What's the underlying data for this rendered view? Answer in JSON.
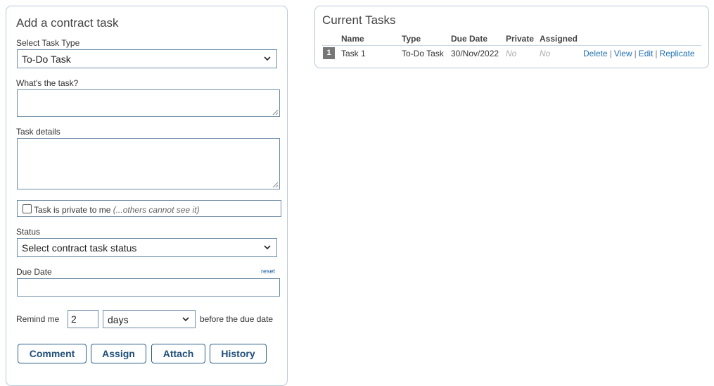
{
  "add_task": {
    "title": "Add a contract task",
    "task_type_label": "Select Task Type",
    "task_type_value": "To-Do Task",
    "whats_task_label": "What's the task?",
    "task_details_label": "Task details",
    "private_label": "Task is private to me",
    "private_hint": "(...others cannot see it)",
    "status_label": "Status",
    "status_value": "Select contract task status",
    "due_date_label": "Due Date",
    "reset_label": "reset",
    "remind_label": "Remind me",
    "remind_value": "2",
    "remind_unit": "days",
    "remind_suffix": "before the due date",
    "buttons": {
      "comment": "Comment",
      "assign": "Assign",
      "attach": "Attach",
      "history": "History"
    }
  },
  "current_tasks": {
    "title": "Current Tasks",
    "columns": [
      "Name",
      "Type",
      "Due Date",
      "Private",
      "Assigned"
    ],
    "rows": [
      {
        "num": "1",
        "name": "Task 1",
        "type": "To-Do Task",
        "due_date": "30/Nov/2022",
        "private": "No",
        "assigned": "No",
        "actions": [
          "Delete",
          "View",
          "Edit",
          "Replicate"
        ]
      }
    ]
  },
  "icons": {
    "select_chevron": "chevron-down-icon",
    "resize_grip": "resize-grip-icon"
  },
  "colors": {
    "border": "#6f8ea8",
    "panel_border": "#b9c9d6",
    "button_text": "#1f4e79",
    "link": "#1f6fb0"
  }
}
